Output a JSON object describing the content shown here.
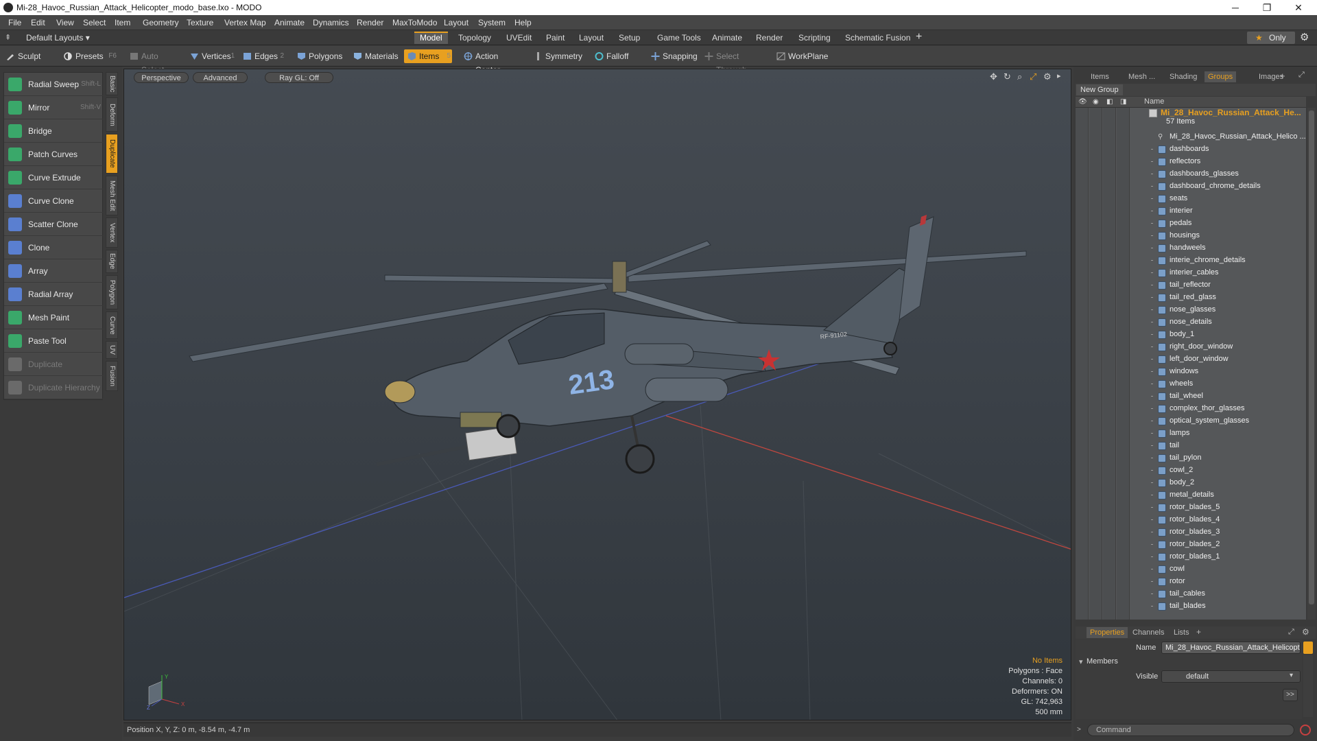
{
  "window": {
    "title": "Mi-28_Havoc_Russian_Attack_Helicopter_modo_base.lxo - MODO",
    "minimize_icon": "─",
    "maximize_icon": "❐",
    "close_icon": "✕"
  },
  "menu": [
    "File",
    "Edit",
    "View",
    "Select",
    "Item",
    "Geometry",
    "Texture",
    "Vertex Map",
    "Animate",
    "Dynamics",
    "Render",
    "MaxToModo",
    "Layout",
    "System",
    "Help"
  ],
  "layoutbar": {
    "layout_selector": "Default Layouts ▾",
    "tabs": [
      "Model",
      "Topology",
      "UVEdit",
      "Paint",
      "Layout",
      "Setup",
      "Game Tools",
      "Animate",
      "Render",
      "Scripting",
      "Schematic Fusion"
    ],
    "active_tab": "Model",
    "add_icon": "+",
    "only_label": "Only",
    "star_icon": "★",
    "gear_icon": "⚙"
  },
  "toolbar": {
    "sculpt": "Sculpt",
    "presets": "Presets",
    "presets_shortcut": "F6",
    "auto_select": "Auto Select",
    "vertices": "Vertices",
    "vertices_count": "1",
    "edges": "Edges",
    "edges_count": "2",
    "polygons": "Polygons",
    "materials": "Materials",
    "items": "Items",
    "items_count": "5",
    "action_center": "Action Center",
    "symmetry": "Symmetry",
    "falloff": "Falloff",
    "snapping": "Snapping",
    "select_through": "Select Through",
    "workplane": "WorkPlane"
  },
  "tools": [
    {
      "label": "Radial Sweep",
      "shortcut": "Shift-L",
      "color": "#3aa86a",
      "enabled": true
    },
    {
      "label": "Mirror",
      "shortcut": "Shift-V",
      "color": "#3aa86a",
      "enabled": true
    },
    {
      "label": "Bridge",
      "shortcut": "",
      "color": "#3aa86a",
      "enabled": true
    },
    {
      "label": "Patch Curves",
      "shortcut": "",
      "color": "#3aa86a",
      "enabled": true
    },
    {
      "label": "Curve Extrude",
      "shortcut": "",
      "color": "#3aa86a",
      "enabled": true
    },
    {
      "label": "Curve Clone",
      "shortcut": "",
      "color": "#5a7fd0",
      "enabled": true
    },
    {
      "label": "Scatter Clone",
      "shortcut": "",
      "color": "#5a7fd0",
      "enabled": true
    },
    {
      "label": "Clone",
      "shortcut": "",
      "color": "#5a7fd0",
      "enabled": true
    },
    {
      "label": "Array",
      "shortcut": "",
      "color": "#5a7fd0",
      "enabled": true
    },
    {
      "label": "Radial Array",
      "shortcut": "",
      "color": "#5a7fd0",
      "enabled": true
    },
    {
      "label": "Mesh Paint",
      "shortcut": "",
      "color": "#3aa86a",
      "enabled": true
    },
    {
      "label": "Paste Tool",
      "shortcut": "",
      "color": "#3aa86a",
      "enabled": true
    },
    {
      "label": "Duplicate",
      "shortcut": "",
      "color": "#6a6a6a",
      "enabled": false
    },
    {
      "label": "Duplicate Hierarchy",
      "shortcut": "",
      "color": "#6a6a6a",
      "enabled": false
    }
  ],
  "side_tabs": [
    "Basic",
    "Deform",
    "Duplicate",
    "Mesh Edit",
    "Vertex",
    "Edge",
    "Polygon",
    "Curve",
    "UV",
    "Fusion"
  ],
  "side_tab_active": "Duplicate",
  "viewport": {
    "view_mode": "Perspective",
    "shading": "Advanced",
    "raygl": "Ray GL: Off",
    "info": {
      "no_items": "No Items",
      "polygons": "Polygons : Face",
      "channels": "Channels: 0",
      "deformers": "Deformers: ON",
      "gl": "GL: 742,963",
      "scale": "500 mm"
    },
    "heli_number": "213",
    "heli_tail_text": "RF-91102",
    "axis_labels": [
      "Y",
      "Z",
      "X"
    ]
  },
  "statusbar": {
    "position": "Position X, Y, Z:  0 m, -8.54 m, -4.7 m"
  },
  "right_tabs": [
    "Items",
    "Mesh ...",
    "Shading",
    "Groups",
    "Images"
  ],
  "right_tab_active": "Groups",
  "groups": {
    "new_group": "New Group",
    "name_header": "Name",
    "root_name": "Mi_28_Havoc_Russian_Attack_He...",
    "root_count": "57 Items",
    "mesh_name": "Mi_28_Havoc_Russian_Attack_Helico ...",
    "items": [
      "dashboards",
      "reflectors",
      "dashboards_glasses",
      "dashboard_chrome_details",
      "seats",
      "interier",
      "pedals",
      "housings",
      "handweels",
      "interie_chrome_details",
      "interier_cables",
      "tail_reflector",
      "tail_red_glass",
      "nose_glasses",
      "nose_details",
      "body_1",
      "right_door_window",
      "left_door_window",
      "windows",
      "wheels",
      "tail_wheel",
      "complex_thor_glasses",
      "optical_system_glasses",
      "lamps",
      "tail",
      "tail_pylon",
      "cowl_2",
      "body_2",
      "metal_details",
      "rotor_blades_5",
      "rotor_blades_4",
      "rotor_blades_3",
      "rotor_blades_2",
      "rotor_blades_1",
      "cowl",
      "rotor",
      "tail_cables",
      "tail_blades"
    ]
  },
  "properties": {
    "tabs": [
      "Properties",
      "Channels",
      "Lists"
    ],
    "active": "Properties",
    "name_label": "Name",
    "name_value": "Mi_28_Havoc_Russian_Attack_Helicopt",
    "members": "Members",
    "visible_label": "Visible",
    "visible_value": "default",
    "arrow": ">>",
    "command_placeholder": "Command"
  },
  "colors": {
    "accent": "#e8a020",
    "viewport_top": "#454b52",
    "viewport_bottom": "#30363c",
    "x_axis": "#c0473f",
    "z_axis": "#4a5ab8"
  }
}
